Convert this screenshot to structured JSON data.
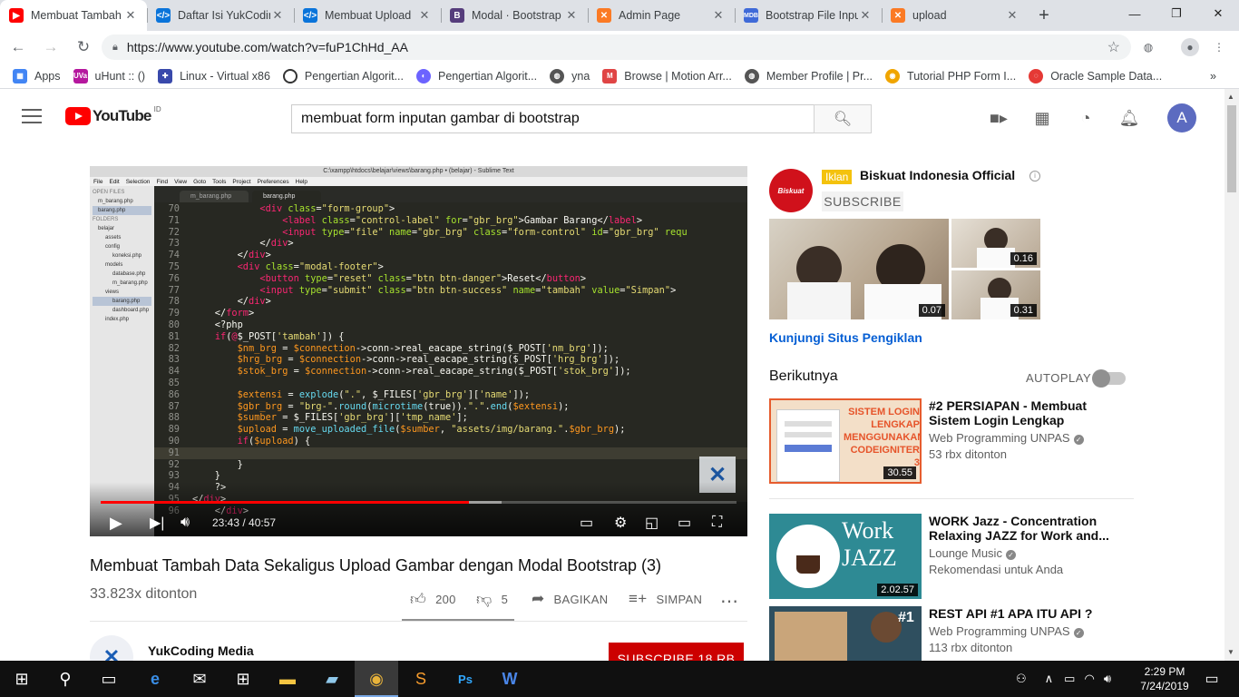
{
  "browser": {
    "tabs": [
      {
        "title": "Membuat Tambah",
        "icon": "youtube-icon",
        "color": "#ff0000",
        "active": true
      },
      {
        "title": "Daftar Isi YukCodin",
        "icon": "code-icon",
        "color": "#0a74da"
      },
      {
        "title": "Membuat Upload",
        "icon": "code-icon",
        "color": "#0a74da"
      },
      {
        "title": "Modal · Bootstrap",
        "icon": "bootstrap-icon",
        "color": "#563d7c"
      },
      {
        "title": "Admin Page",
        "icon": "xampp-icon",
        "color": "#fb7a24"
      },
      {
        "title": "Bootstrap File Inpu",
        "icon": "mdb-icon",
        "color": "#3f6ad8"
      },
      {
        "title": "upload",
        "icon": "xampp-icon",
        "color": "#fb7a24"
      }
    ],
    "url": "https://www.youtube.com/watch?v=fuP1ChHd_AA",
    "bookmarks": [
      {
        "label": "Apps",
        "icon": "apps-grid-icon",
        "color": "#4285f4"
      },
      {
        "label": "uHunt :: ()",
        "icon": "uva-icon",
        "color": "#b5179e"
      },
      {
        "label": "Linux - Virtual x86",
        "icon": "puzzle-icon",
        "color": "#3949ab"
      },
      {
        "label": "Pengertian Algorit...",
        "icon": "circle-icon",
        "color": "#333333"
      },
      {
        "label": "Pengertian Algorit...",
        "icon": "swirl-icon",
        "color": "#6c63ff"
      },
      {
        "label": "yna",
        "icon": "globe-icon",
        "color": "#555555"
      },
      {
        "label": "Browse | Motion Arr...",
        "icon": "motion-array-icon",
        "color": "#e04545"
      },
      {
        "label": "Member Profile | Pr...",
        "icon": "globe-icon",
        "color": "#555555"
      },
      {
        "label": "Tutorial PHP Form I...",
        "icon": "tutorial-icon",
        "color": "#f0a500"
      },
      {
        "label": "Oracle Sample Data...",
        "icon": "oracle-icon",
        "color": "#e53935"
      }
    ]
  },
  "youtube": {
    "logo_text": "YouTube",
    "region": "ID",
    "search_query": "membuat form inputan gambar di bootstrap",
    "avatar_letter": "A"
  },
  "player": {
    "editor_title": "C:\\xampp\\htdocs\\belajar\\views\\barang.php • (belajar) - Sublime Text",
    "menu": [
      "File",
      "Edit",
      "Selection",
      "Find",
      "View",
      "Goto",
      "Tools",
      "Project",
      "Preferences",
      "Help"
    ],
    "sidebar": [
      "OPEN FILES",
      "m_barang.php",
      "barang.php",
      "FOLDERS",
      "belajar",
      "assets",
      "config",
      "koneksi.php",
      "models",
      "database.php",
      "m_barang.php",
      "views",
      "barang.php",
      "dashboard.php",
      "index.php"
    ],
    "tabs": [
      "m_barang.php",
      "barang.php"
    ],
    "time_current": "23:43",
    "time_sep": " / ",
    "time_total": "40:57",
    "progress": 0.579,
    "buffered": 0.63
  },
  "video": {
    "title": "Membuat Tambah Data Sekaligus Upload Gambar dengan Modal Bootstrap (3)",
    "views": "33.823x ditonton",
    "likes": "200",
    "dislikes": "5",
    "share_label": "BAGIKAN",
    "save_label": "SIMPAN",
    "channel": "YukCoding Media",
    "subscribe_label": "SUBSCRIBE",
    "subscriber_count": "18 RB"
  },
  "ad": {
    "badge": "Iklan",
    "advertiser": "Biskuat Indonesia Official",
    "logo_text": "Biskuat",
    "subscribe_label": "SUBSCRIBE",
    "durations": [
      "0.07",
      "0.16",
      "0.31"
    ],
    "link_text": "Kunjungi Situs Pengiklan"
  },
  "sidebar": {
    "next_label": "Berikutnya",
    "autoplay_label": "AUTOPLAY",
    "autoplay_on": false,
    "videos": [
      {
        "title": "#2 PERSIAPAN - Membuat Sistem Login Lengkap dengan...",
        "channel": "Web Programming UNPAS",
        "meta": "53 rbx ditonton",
        "duration": "30.55",
        "thumb_text": "SISTEM LOGIN LENGKAP MENGGUNAKAN CODEIGNITER 3"
      },
      {
        "title": "WORK Jazz - Concentration Relaxing JAZZ for Work and...",
        "channel": "Lounge Music",
        "meta": "Rekomendasi untuk Anda",
        "duration": "2.02.57",
        "thumb_text": "Work JAZZ"
      },
      {
        "title": "REST API #1 APA ITU API ?",
        "channel": "Web Programming UNPAS",
        "meta": "113 rbx ditonton",
        "duration": "",
        "thumb_text": "#1"
      }
    ]
  },
  "taskbar": {
    "time": "2:29 PM",
    "date": "7/24/2019"
  }
}
